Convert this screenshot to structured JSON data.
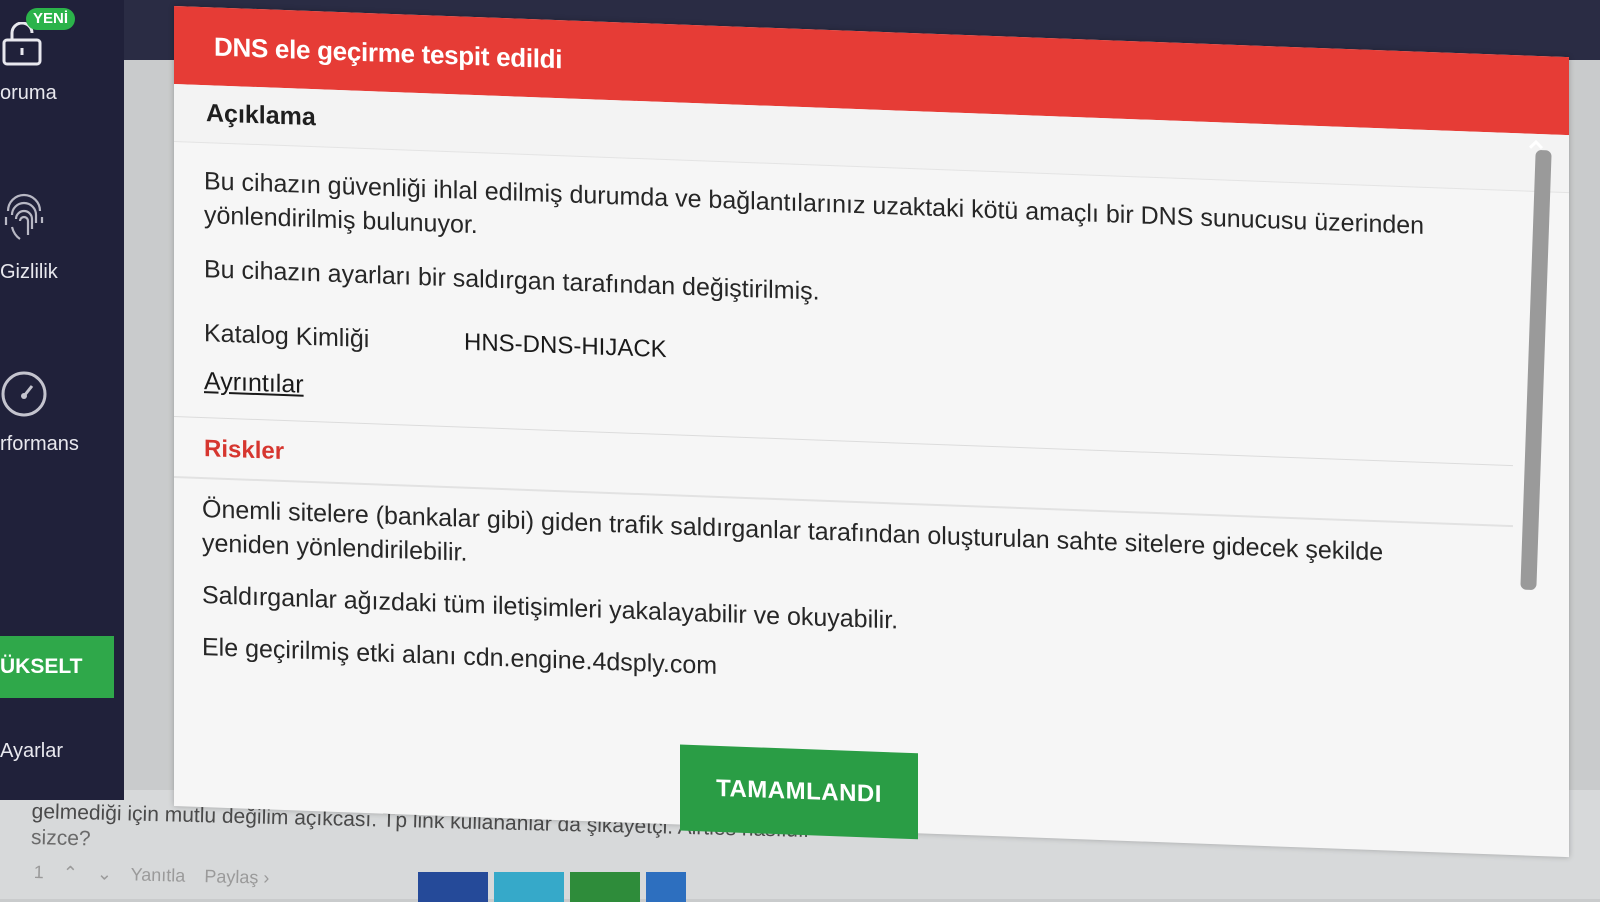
{
  "sidebar": {
    "badge": "YENİ",
    "items": [
      {
        "label": "oruma",
        "icon": "lock-icon"
      },
      {
        "label": "Gizlilik",
        "icon": "fingerprint-icon"
      },
      {
        "label": "rformans",
        "icon": "speedometer-icon"
      },
      {
        "label": "Ayarlar",
        "icon": "gear-icon"
      }
    ],
    "upgrade_label": "ÜKSELT"
  },
  "dialog": {
    "title": "DNS ele geçirme tespit edildi",
    "section_title": "Açıklama",
    "description": [
      "Bu cihazın güvenliği ihlal edilmiş durumda ve bağlantılarınız uzaktaki kötü amaçlı bir DNS sunucusu üzerinden",
      "yönlendirilmiş bulunuyor.",
      "Bu cihazın ayarları bir saldırgan tarafından değiştirilmiş."
    ],
    "catalog_label": "Katalog Kimliği",
    "catalog_value": "HNS-DNS-HIJACK",
    "details_link": "Ayrıntılar",
    "risks_title": "Riskler",
    "risks": [
      "Önemli sitelere (bankalar gibi) giden trafik saldırganlar tarafından oluşturulan sahte sitelere gidecek şekilde",
      "yeniden yönlendirilebilir.",
      "Saldırganlar ağızdaki tüm iletişimleri yakalayabilir ve okuyabilir.",
      "Ele geçirilmiş etki alanı cdn.engine.4dsply.com"
    ],
    "done_button": "TAMAMLANDI"
  },
  "background_page": {
    "comment_line1": "gelmediği için mutlu değilim açıkcası. Tp link kullananlar da şikayetçi. Airties nasıldır",
    "comment_line2": "sizce?",
    "vote_count": "1",
    "reply": "Yanıtla",
    "share": "Paylaş ›"
  },
  "colors": {
    "header": "#e63c36",
    "sidebar": "#20213a",
    "accent_green": "#2a9d45",
    "risk_red": "#d6362f"
  }
}
